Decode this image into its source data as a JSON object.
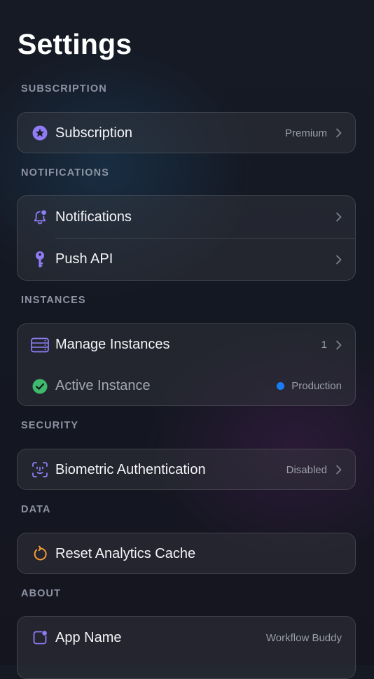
{
  "page": {
    "title": "Settings"
  },
  "sections": {
    "subscription": {
      "header": "SUBSCRIPTION",
      "rows": [
        {
          "label": "Subscription",
          "value": "Premium",
          "icon": "star-badge-icon"
        }
      ]
    },
    "notifications": {
      "header": "NOTIFICATIONS",
      "rows": [
        {
          "label": "Notifications",
          "icon": "bell-badge-icon"
        },
        {
          "label": "Push API",
          "icon": "key-icon"
        }
      ]
    },
    "instances": {
      "header": "INSTANCES",
      "rows": [
        {
          "label": "Manage Instances",
          "value": "1",
          "icon": "server-rack-icon"
        },
        {
          "label": "Active Instance",
          "value": "Production",
          "icon": "checkmark-circle-icon"
        }
      ]
    },
    "security": {
      "header": "SECURITY",
      "rows": [
        {
          "label": "Biometric Authentication",
          "value": "Disabled",
          "icon": "face-id-icon"
        }
      ]
    },
    "data": {
      "header": "DATA",
      "rows": [
        {
          "label": "Reset Analytics Cache",
          "icon": "reset-arrow-icon"
        }
      ]
    },
    "about": {
      "header": "ABOUT",
      "rows": [
        {
          "label": "App Name",
          "value": "Workflow Buddy",
          "icon": "app-badge-icon"
        }
      ]
    }
  },
  "colors": {
    "accent_purple": "#8f7cf5",
    "success_green": "#3fb96b",
    "status_blue": "#1a7cf5",
    "reset_orange": "#f29a3a"
  }
}
